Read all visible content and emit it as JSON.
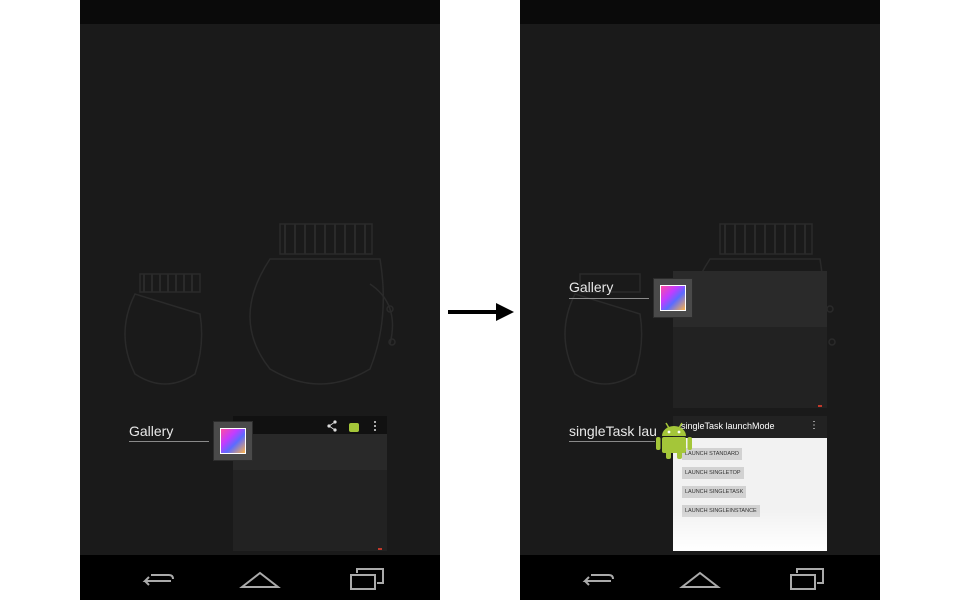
{
  "left_screen": {
    "recents": [
      {
        "label": "Gallery",
        "icon": "gallery-app-icon"
      }
    ],
    "gallery_thumb_actions": [
      "share-icon",
      "android-icon",
      "overflow-menu-icon"
    ]
  },
  "arrow": {
    "icon": "right-arrow-icon"
  },
  "right_screen": {
    "recents": [
      {
        "label": "Gallery",
        "icon": "gallery-app-icon"
      },
      {
        "label": "singleTask lau",
        "icon": "android-robot-icon"
      }
    ],
    "singletask_app": {
      "title": "singleTask launchMode",
      "overflow": "⋮",
      "buttons": [
        "LAUNCH STANDARD",
        "LAUNCH SINGLETOP",
        "LAUNCH SINGLETASK",
        "LAUNCH SINGLEINSTANCE"
      ]
    }
  },
  "nav_bar": {
    "icons": [
      "back-icon",
      "home-icon",
      "recent-apps-icon"
    ]
  },
  "colors": {
    "background": "#141414",
    "android_green": "#a4c639",
    "nav_bar": "#000000"
  }
}
